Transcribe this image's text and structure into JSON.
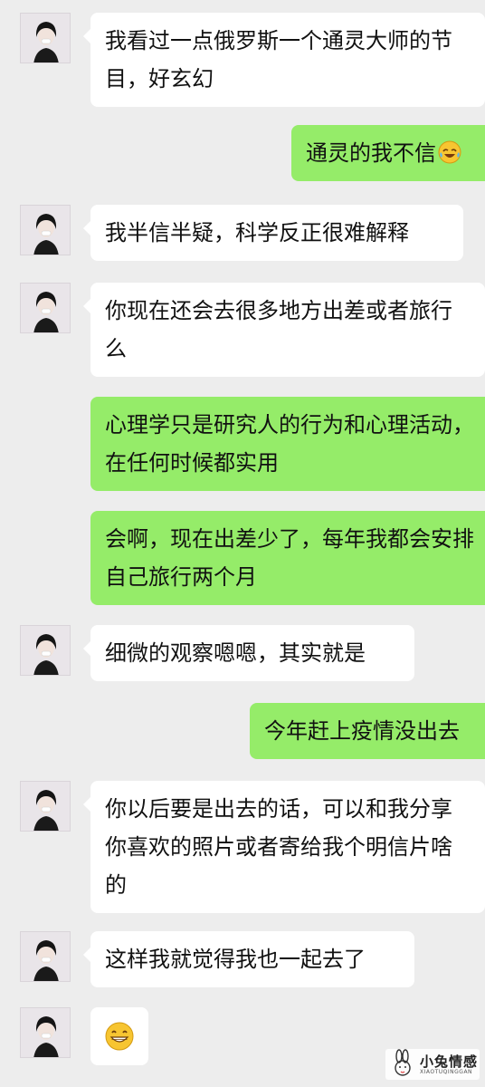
{
  "colors": {
    "background": "#ededed",
    "incoming_bubble": "#ffffff",
    "outgoing_bubble": "#95ec69"
  },
  "messages": [
    {
      "side": "in",
      "text": "我看过一点俄罗斯一个通灵大师的节目，好玄幻"
    },
    {
      "side": "out",
      "text": "通灵的我不信",
      "emoji": "laugh-cry-emoji"
    },
    {
      "side": "in",
      "text": "我半信半疑，科学反正很难解释"
    },
    {
      "side": "in",
      "text": "你现在还会去很多地方出差或者旅行么"
    },
    {
      "side": "out",
      "text": "心理学只是研究人的行为和心理活动，在任何时候都实用"
    },
    {
      "side": "out",
      "text": "会啊，现在出差少了，每年我都会安排自己旅行两个月"
    },
    {
      "side": "in",
      "text": "细微的观察嗯嗯，其实就是"
    },
    {
      "side": "out",
      "text": "今年赶上疫情没出去"
    },
    {
      "side": "in",
      "text": "你以后要是出去的话，可以和我分享你喜欢的照片或者寄给我个明信片啥的"
    },
    {
      "side": "in",
      "text": "这样我就觉得我也一起去了"
    },
    {
      "side": "in",
      "sticker": "grinning-emoji"
    }
  ],
  "watermark": {
    "title": "小兔情感",
    "subtitle": "XIAOTUQINGGAN"
  }
}
